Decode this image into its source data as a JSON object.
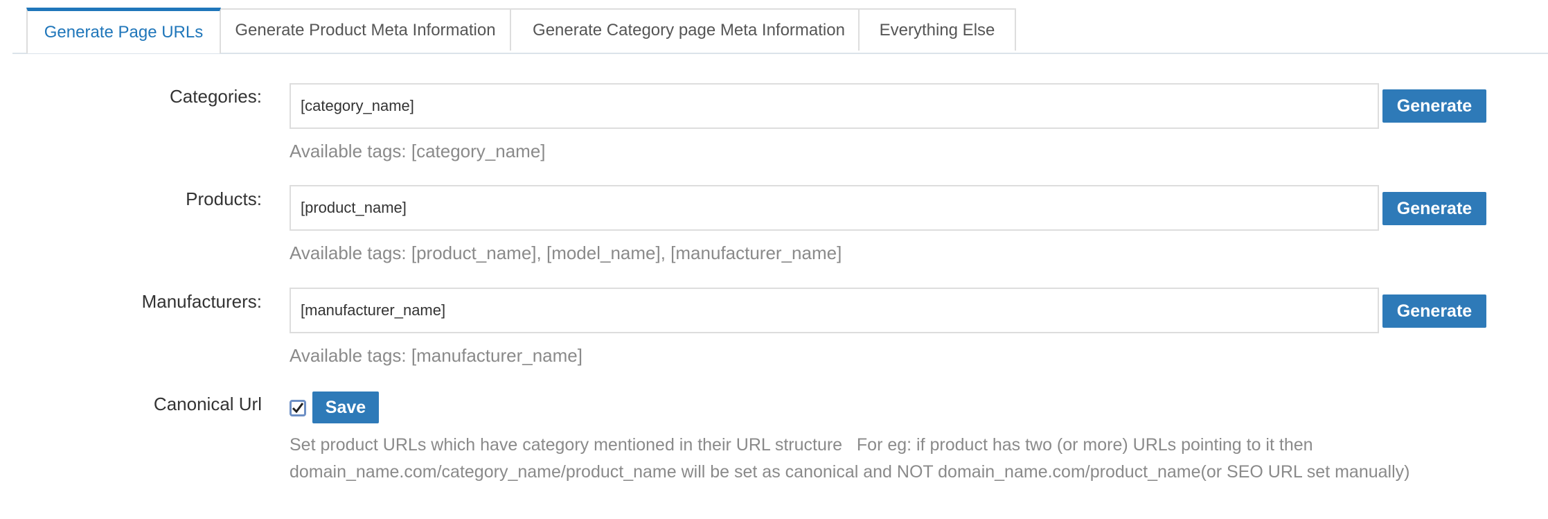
{
  "tabs": [
    {
      "label": "Generate Page URLs",
      "active": true
    },
    {
      "label": "Generate Product Meta Information",
      "active": false
    },
    {
      "label": "Generate Category page Meta Information",
      "active": false
    },
    {
      "label": "Everything Else",
      "active": false
    }
  ],
  "rows": {
    "categories": {
      "label": "Categories:",
      "value": "[category_name]",
      "button": "Generate",
      "help": "Available tags: [category_name]"
    },
    "products": {
      "label": "Products:",
      "value": "[product_name]",
      "button": "Generate",
      "help": "Available tags: [product_name], [model_name], [manufacturer_name]"
    },
    "manufacturers": {
      "label": "Manufacturers:",
      "value": "[manufacturer_name]",
      "button": "Generate",
      "help": "Available tags: [manufacturer_name]"
    }
  },
  "canonical": {
    "label": "Canonical Url",
    "checked": true,
    "save_label": "Save",
    "description_line1": "Set product URLs which have category mentioned in their URL structure   For eg: if product has two (or more) URLs pointing to it then",
    "description_line2": "domain_name.com/category_name/product_name will be set as canonical and NOT domain_name.com/product_name(or SEO URL set manually)"
  },
  "colors": {
    "accent": "#1f76ba",
    "button": "#2e7ab8",
    "help_text": "#8a8a8a"
  }
}
